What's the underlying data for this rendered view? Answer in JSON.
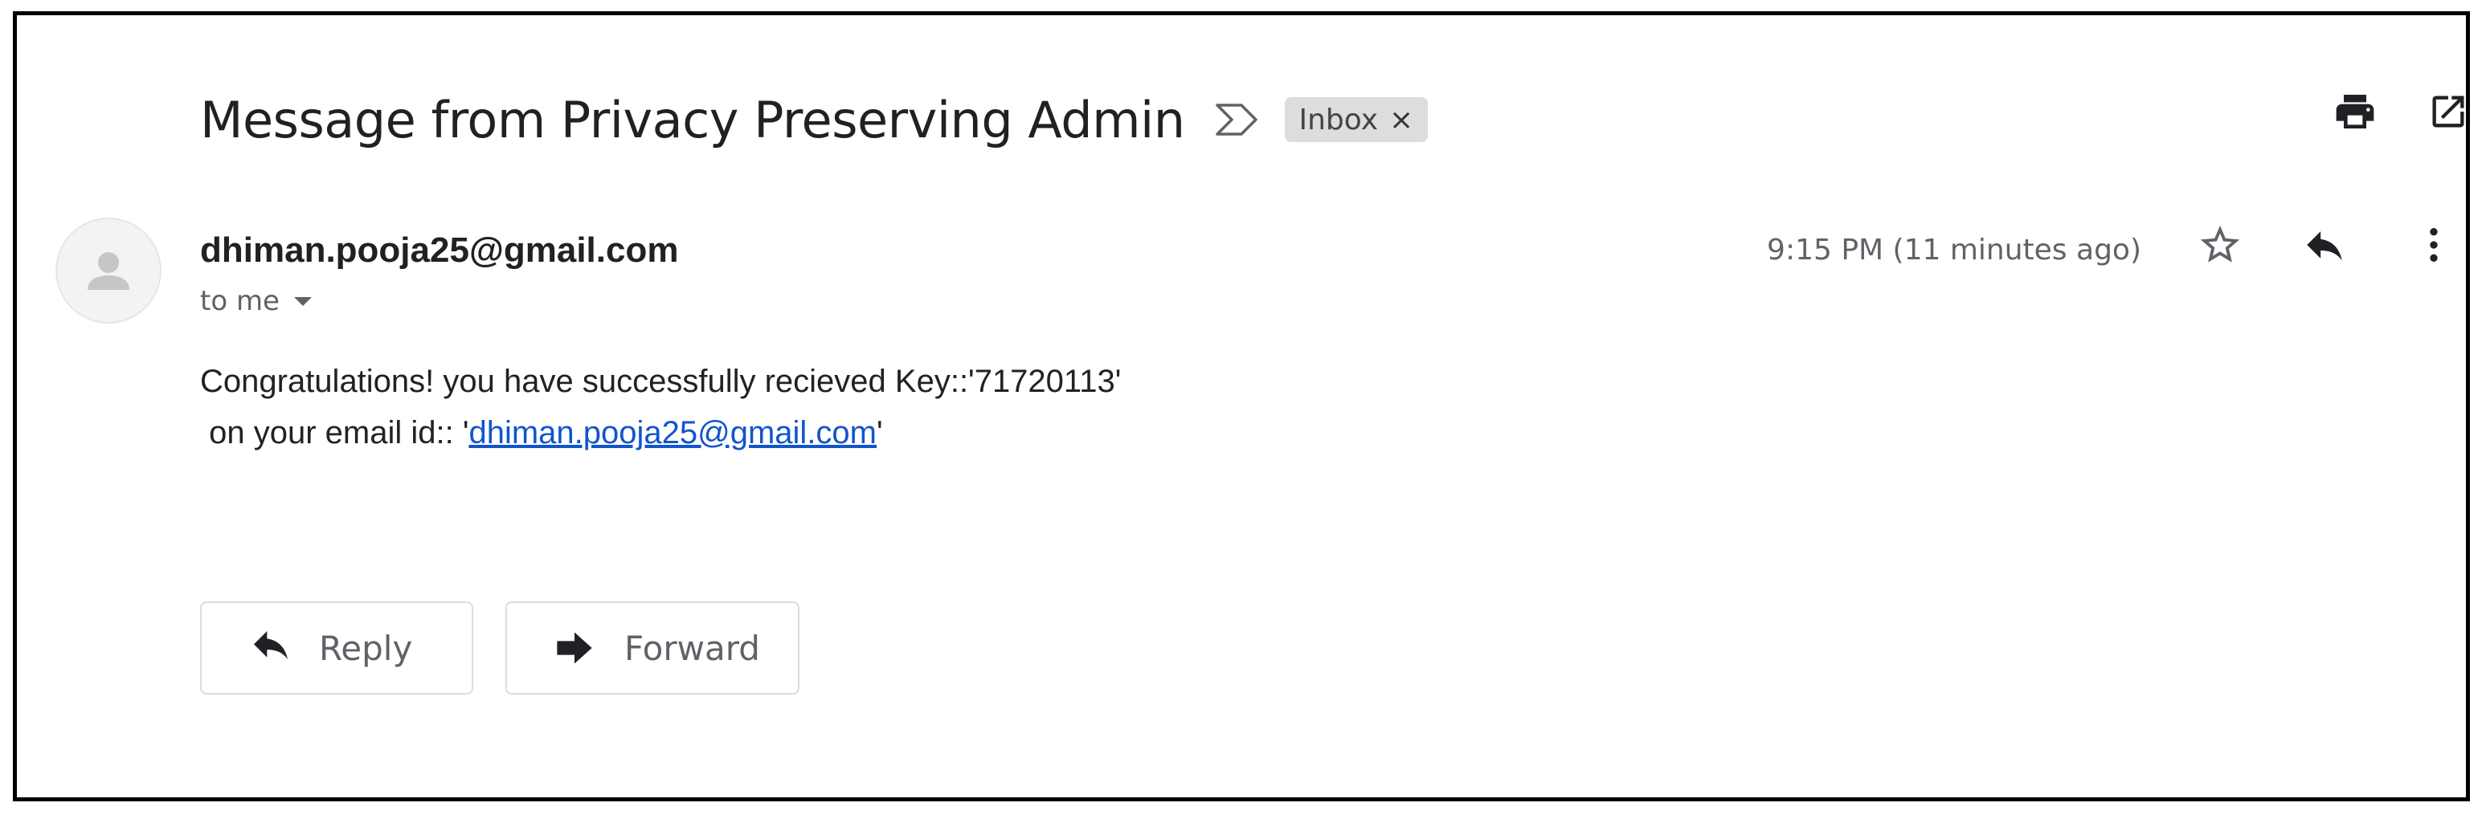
{
  "email": {
    "subject": "Message from Privacy Preserving Admin",
    "importance_icon": "importance-marker-icon",
    "label": {
      "text": "Inbox",
      "remove": "×"
    },
    "header_actions": [
      {
        "name": "print-all-icon",
        "icon": "printer"
      },
      {
        "name": "open-new-window-icon",
        "icon": "external-link"
      }
    ],
    "sender": "dhiman.pooja25@gmail.com",
    "recipient": "to me",
    "timestamp": "9:15 PM (11 minutes ago)",
    "message_actions": [
      {
        "name": "star-icon",
        "icon": "star-outline"
      },
      {
        "name": "reply-icon",
        "icon": "reply-arrow"
      },
      {
        "name": "more-options-icon",
        "icon": "vertical-dots"
      }
    ],
    "body": {
      "line1": "Congratulations! you have successfully recieved Key::'71720113'",
      "line2_prefix": " on your email id:: '",
      "line2_link": "dhiman.pooja25@gmail.com",
      "line2_suffix": "'"
    },
    "buttons": {
      "reply": "Reply",
      "forward": "Forward"
    }
  },
  "colors": {
    "text_primary": "#202124",
    "text_secondary": "#5f6368",
    "link": "#1155cc",
    "chip_bg": "#dddddd",
    "border": "#dadce0"
  }
}
